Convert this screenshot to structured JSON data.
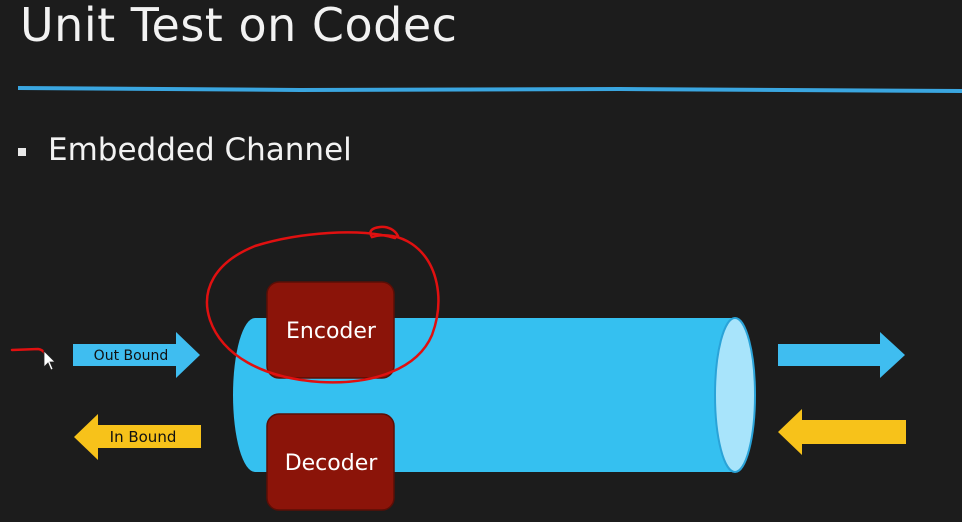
{
  "slide": {
    "title": "Unit Test on Codec",
    "bullets": [
      "Embedded Channel"
    ]
  },
  "diagram": {
    "encoder_label": "Encoder",
    "decoder_label": "Decoder",
    "out_bound_label": "Out Bound",
    "in_bound_label": "In Bound"
  },
  "colors": {
    "background": "#1c1c1c",
    "title_text": "#f2f2f2",
    "rule_line": "#3aa6e0",
    "channel_cylinder": "#35c0f0",
    "channel_end": "#a8e4fb",
    "codec_box": "#8b1409",
    "outbound_arrow": "#3fbdf0",
    "inbound_arrow": "#f7c21a",
    "annotation_ink": "#e01010"
  }
}
